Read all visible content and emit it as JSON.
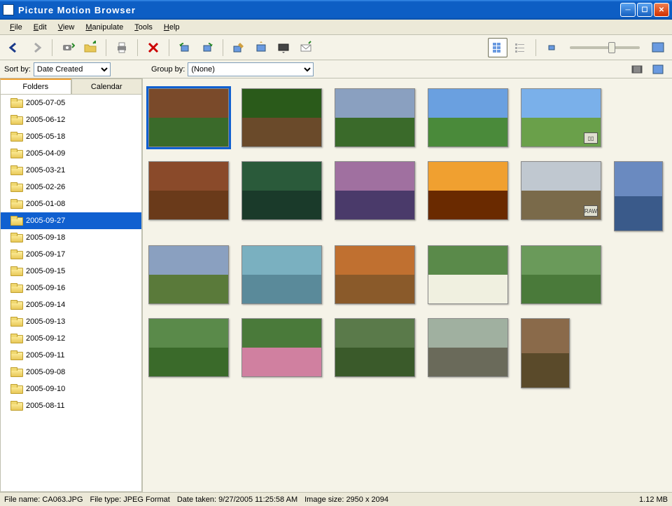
{
  "window": {
    "title": "Picture Motion Browser"
  },
  "menu": [
    "File",
    "Edit",
    "View",
    "Manipulate",
    "Tools",
    "Help"
  ],
  "sort": {
    "label": "Sort by:",
    "value": "Date Created"
  },
  "group": {
    "label": "Group by:",
    "value": "(None)"
  },
  "tabs": {
    "folders": "Folders",
    "calendar": "Calendar"
  },
  "folders": [
    {
      "name": "2005-07-05",
      "sel": false
    },
    {
      "name": "2005-06-12",
      "sel": false
    },
    {
      "name": "2005-05-18",
      "sel": false
    },
    {
      "name": "2005-04-09",
      "sel": false
    },
    {
      "name": "2005-03-21",
      "sel": false
    },
    {
      "name": "2005-02-26",
      "sel": false
    },
    {
      "name": "2005-01-08",
      "sel": false
    },
    {
      "name": "2005-09-27",
      "sel": true
    },
    {
      "name": "2005-09-18",
      "sel": false
    },
    {
      "name": "2005-09-17",
      "sel": false
    },
    {
      "name": "2005-09-15",
      "sel": false
    },
    {
      "name": "2005-09-16",
      "sel": false
    },
    {
      "name": "2005-09-14",
      "sel": false
    },
    {
      "name": "2005-09-13",
      "sel": false
    },
    {
      "name": "2005-09-12",
      "sel": false
    },
    {
      "name": "2005-09-11",
      "sel": false
    },
    {
      "name": "2005-09-08",
      "sel": false
    },
    {
      "name": "2005-09-10",
      "sel": false
    },
    {
      "name": "2005-08-11",
      "sel": false
    }
  ],
  "thumbs": [
    {
      "c1": "#7a4a2a",
      "c2": "#3a6a2a",
      "sel": true,
      "badge": null,
      "portrait": false
    },
    {
      "c1": "#2a5a1a",
      "c2": "#6a4a2a",
      "sel": false,
      "badge": null,
      "portrait": false
    },
    {
      "c1": "#8aa0c0",
      "c2": "#3a6a2a",
      "sel": false,
      "badge": null,
      "portrait": false
    },
    {
      "c1": "#6aa0e0",
      "c2": "#4a8a3a",
      "sel": false,
      "badge": null,
      "portrait": false
    },
    {
      "c1": "#7ab0ea",
      "c2": "#6aa04a",
      "sel": false,
      "badge": "▯▯",
      "portrait": false
    },
    {
      "c1": "#8a4a2a",
      "c2": "#6a3a1a",
      "sel": false,
      "badge": null,
      "portrait": false
    },
    {
      "c1": "#2a5a3a",
      "c2": "#1a3a2a",
      "sel": false,
      "badge": null,
      "portrait": false
    },
    {
      "c1": "#a070a0",
      "c2": "#4a3a6a",
      "sel": false,
      "badge": null,
      "portrait": false
    },
    {
      "c1": "#f0a030",
      "c2": "#6a2a00",
      "sel": false,
      "badge": null,
      "portrait": false
    },
    {
      "c1": "#c0c8d0",
      "c2": "#7a6a4a",
      "sel": false,
      "badge": "RAW",
      "portrait": false
    },
    {
      "c1": "#6a8ac0",
      "c2": "#3a5a8a",
      "sel": false,
      "badge": null,
      "portrait": true
    },
    {
      "c1": "#8aa0c0",
      "c2": "#5a7a3a",
      "sel": false,
      "badge": null,
      "portrait": false
    },
    {
      "c1": "#7ab0c0",
      "c2": "#5a8a9a",
      "sel": false,
      "badge": null,
      "portrait": false
    },
    {
      "c1": "#c07030",
      "c2": "#8a5a2a",
      "sel": false,
      "badge": null,
      "portrait": false
    },
    {
      "c1": "#5a8a4a",
      "c2": "#f0f0e0",
      "sel": false,
      "badge": null,
      "portrait": false
    },
    {
      "c1": "#6a9a5a",
      "c2": "#4a7a3a",
      "sel": false,
      "badge": null,
      "portrait": false
    },
    {
      "c1": "#5a8a4a",
      "c2": "#3a6a2a",
      "sel": false,
      "badge": null,
      "portrait": false
    },
    {
      "c1": "#4a7a3a",
      "c2": "#d080a0",
      "sel": false,
      "badge": null,
      "portrait": false
    },
    {
      "c1": "#5a7a4a",
      "c2": "#3a5a2a",
      "sel": false,
      "badge": null,
      "portrait": false
    },
    {
      "c1": "#a0b0a0",
      "c2": "#6a6a5a",
      "sel": false,
      "badge": null,
      "portrait": false
    },
    {
      "c1": "#8a6a4a",
      "c2": "#5a4a2a",
      "sel": false,
      "badge": null,
      "portrait": true
    }
  ],
  "status": {
    "filename_lbl": "File name:",
    "filename": "CA063.JPG",
    "filetype_lbl": "File type:",
    "filetype": "JPEG Format",
    "datetaken_lbl": "Date taken:",
    "datetaken": "9/27/2005 11:25:58 AM",
    "imagesize_lbl": "Image size:",
    "imagesize": "2950 x 2094",
    "filesize": "1.12 MB"
  }
}
